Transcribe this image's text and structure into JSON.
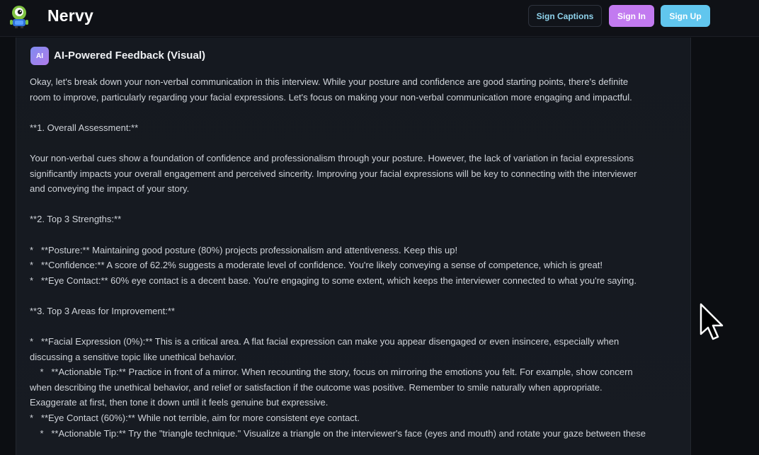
{
  "header": {
    "brand": "Nervy",
    "buttons": {
      "captions": "Sign Captions",
      "signin": "Sign In",
      "signup": "Sign Up"
    },
    "colors": {
      "signin": "#c27af0",
      "signup": "#61c6ee",
      "captions_text": "#8fd3ec"
    }
  },
  "panel": {
    "badge": "AI",
    "title": "AI-Powered Feedback (Visual)",
    "lines": [
      "Okay, let's break down your non-verbal communication in this interview. While your posture and confidence are good starting points, there's definite",
      "room to improve, particularly regarding your facial expressions. Let's focus on making your non-verbal communication more engaging and impactful.",
      "",
      "**1. Overall Assessment:**",
      "",
      "Your non-verbal cues show a foundation of confidence and professionalism through your posture. However, the lack of variation in facial expressions",
      "significantly impacts your overall engagement and perceived sincerity. Improving your facial expressions will be key to connecting with the interviewer",
      "and conveying the impact of your story.",
      "",
      "**2. Top 3 Strengths:**",
      "",
      "*   **Posture:** Maintaining good posture (80%) projects professionalism and attentiveness. Keep this up!",
      "*   **Confidence:** A score of 62.2% suggests a moderate level of confidence. You're likely conveying a sense of competence, which is great!",
      "*   **Eye Contact:** 60% eye contact is a decent base. You're engaging to some extent, which keeps the interviewer connected to what you're saying.",
      "",
      "**3. Top 3 Areas for Improvement:**",
      "",
      "*   **Facial Expression (0%):** This is a critical area. A flat facial expression can make you appear disengaged or even insincere, especially when",
      "discussing a sensitive topic like unethical behavior.",
      "    *   **Actionable Tip:** Practice in front of a mirror. When recounting the story, focus on mirroring the emotions you felt. For example, show concern",
      "when describing the unethical behavior, and relief or satisfaction if the outcome was positive. Remember to smile naturally when appropriate.",
      "Exaggerate at first, then tone it down until it feels genuine but expressive.",
      "*   **Eye Contact (60%):** While not terrible, aim for more consistent eye contact.",
      "    *   **Actionable Tip:** Try the \"triangle technique.\" Visualize a triangle on the interviewer's face (eyes and mouth) and rotate your gaze between these"
    ]
  },
  "icons": {
    "logo": "robot-mascot-icon",
    "cursor": "mouse-pointer-icon"
  }
}
